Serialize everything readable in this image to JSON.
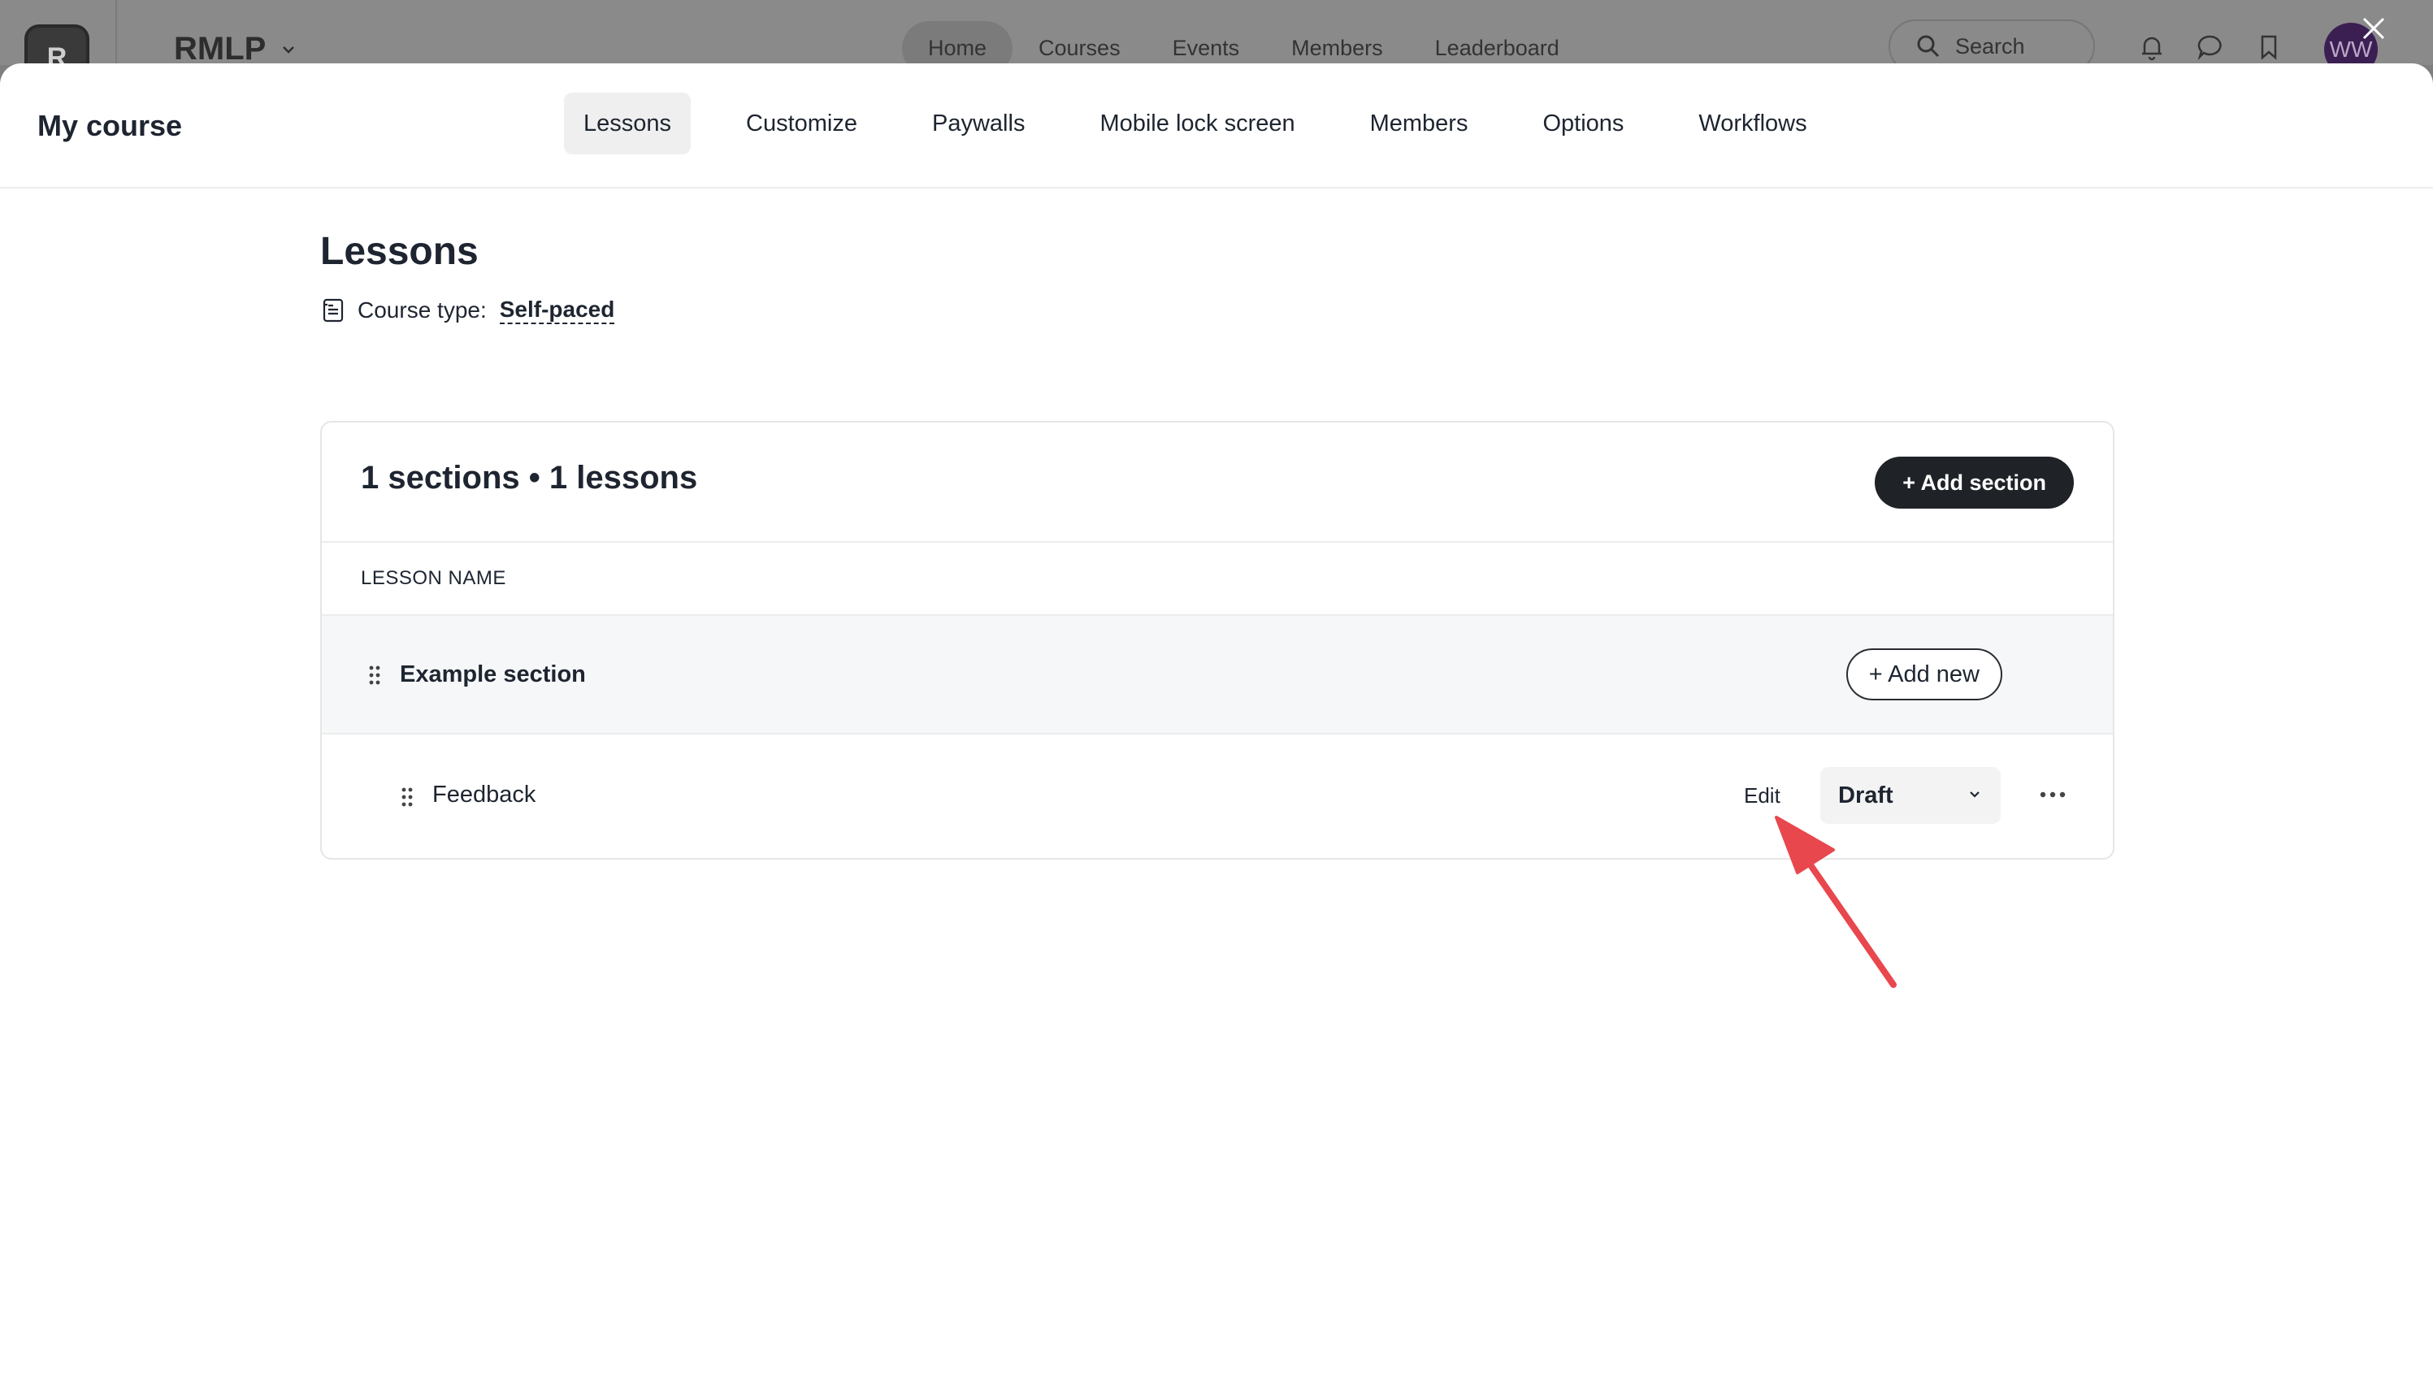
{
  "background": {
    "logo_letter": "R",
    "brand": "RMLP",
    "nav": [
      "Home",
      "Courses",
      "Events",
      "Members",
      "Leaderboard"
    ],
    "search_label": "Search",
    "avatar_initials": "WW"
  },
  "header": {
    "title": "My course",
    "tabs": [
      {
        "label": "Lessons",
        "active": true
      },
      {
        "label": "Customize"
      },
      {
        "label": "Paywalls"
      },
      {
        "label": "Mobile lock screen"
      },
      {
        "label": "Members"
      },
      {
        "label": "Options"
      },
      {
        "label": "Workflows"
      }
    ]
  },
  "main": {
    "heading": "Lessons",
    "course_type_label": "Course type:",
    "course_type_value": "Self-paced",
    "summary": "1 sections • 1 lessons",
    "add_section_label": "+ Add section",
    "column_header": "LESSON NAME",
    "section": {
      "name": "Example section",
      "add_new_label": "+ Add new"
    },
    "lesson": {
      "name": "Feedback",
      "edit_label": "Edit",
      "status": "Draft"
    }
  },
  "colors": {
    "primary_dark": "#1f2226",
    "annotation_arrow": "#e8474d",
    "avatar": "#3c1f52"
  }
}
